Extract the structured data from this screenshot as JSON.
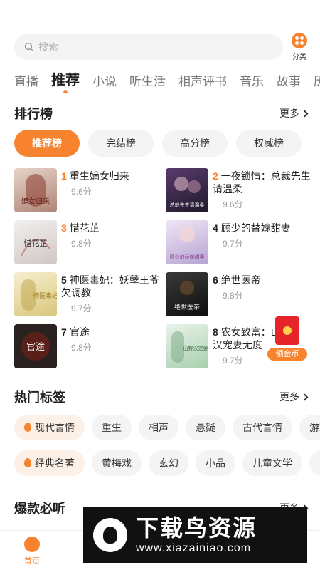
{
  "search": {
    "placeholder": "搜索"
  },
  "category": {
    "label": "分类"
  },
  "tabs": [
    {
      "label": "直播"
    },
    {
      "label": "推荐"
    },
    {
      "label": "小说"
    },
    {
      "label": "听生活"
    },
    {
      "label": "相声评书"
    },
    {
      "label": "音乐"
    },
    {
      "label": "故事"
    },
    {
      "label": "历"
    }
  ],
  "ranking": {
    "title": "排行榜",
    "more": "更多",
    "tabs": [
      {
        "label": "推荐榜"
      },
      {
        "label": "完结榜"
      },
      {
        "label": "高分榜"
      },
      {
        "label": "权威榜"
      }
    ],
    "books": [
      {
        "rank": "1",
        "title": "重生嫡女归来",
        "score": "9.6分"
      },
      {
        "rank": "2",
        "title": "一夜锁情：总裁先生请温柔",
        "score": "9.6分"
      },
      {
        "rank": "3",
        "title": "惜花芷",
        "score": "9.8分"
      },
      {
        "rank": "4",
        "title": "顾少的替嫁甜妻",
        "score": "9.7分"
      },
      {
        "rank": "5",
        "title": "神医毒妃：妖孽王爷欠调教",
        "score": "9.7分"
      },
      {
        "rank": "6",
        "title": "绝世医帝",
        "score": "9.8分"
      },
      {
        "rank": "7",
        "title": "官途",
        "score": "9.8分"
      },
      {
        "rank": "8",
        "title": "农女致富：山野汉宠妻无度",
        "score": "9.7分"
      }
    ],
    "covers": [
      {
        "text": "嫡女归来",
        "bg": "#c9a9a0"
      },
      {
        "text": "总裁先生请温柔",
        "bg": "#3a2a4a"
      },
      {
        "text": "惜花芷",
        "bg": "#e9e5e4"
      },
      {
        "text": "顾少的替嫁甜妻",
        "bg": "#d8cde6"
      },
      {
        "text": "神医毒妃",
        "bg": "#efe6b8"
      },
      {
        "text": "绝世医帝",
        "bg": "#1d1d1d"
      },
      {
        "text": "官途",
        "bg": "#2a2220"
      },
      {
        "text": "山野汉宠妻",
        "bg": "#cfe4d2"
      }
    ]
  },
  "tags": {
    "title": "热门标签",
    "more": "更多",
    "row1": [
      {
        "label": "现代言情"
      },
      {
        "label": "重生"
      },
      {
        "label": "相声"
      },
      {
        "label": "悬疑"
      },
      {
        "label": "古代言情"
      },
      {
        "label": "游戏"
      }
    ],
    "row2": [
      {
        "label": "经典名著"
      },
      {
        "label": "黄梅戏"
      },
      {
        "label": "玄幻"
      },
      {
        "label": "小品"
      },
      {
        "label": "儿童文学"
      },
      {
        "label": "悬"
      }
    ]
  },
  "hits": {
    "title": "爆款必听",
    "more": "更多"
  },
  "float": {
    "label": "领金币"
  },
  "nav": {
    "home": "首页"
  },
  "watermark": {
    "main": "下载鸟资源",
    "url": "www.xiazainiao.com"
  },
  "colors": {
    "accent": "#f7832e"
  }
}
